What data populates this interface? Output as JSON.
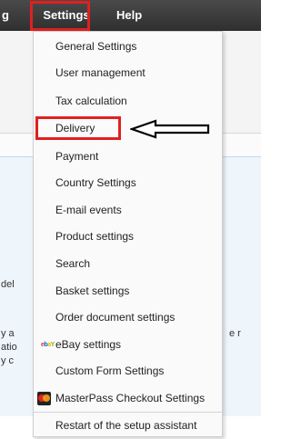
{
  "menubar": {
    "partial_left": "g",
    "settings": "Settings",
    "help": "Help"
  },
  "background": {
    "fragments": [
      "del",
      "y a",
      "atio",
      "y c",
      "e r"
    ]
  },
  "dropdown": {
    "items": [
      {
        "label": "General Settings"
      },
      {
        "label": "User management"
      },
      {
        "label": "Tax calculation"
      },
      {
        "label": "Delivery"
      },
      {
        "label": "Payment"
      },
      {
        "label": "Country Settings"
      },
      {
        "label": "E-mail events"
      },
      {
        "label": "Product settings"
      },
      {
        "label": "Search"
      },
      {
        "label": "Basket settings"
      },
      {
        "label": "Order document settings"
      },
      {
        "label": "eBay settings",
        "icon": "ebay-icon"
      },
      {
        "label": "Custom Form Settings"
      },
      {
        "label": "MasterPass Checkout Settings",
        "icon": "masterpass-icon"
      },
      {
        "label": "Restart of the setup assistant"
      }
    ]
  },
  "ebay_logo": {
    "e": "e",
    "b": "b",
    "a": "a",
    "y": "Y"
  },
  "highlight": {
    "color": "#e02020",
    "highlighted": [
      "Settings",
      "Delivery"
    ]
  }
}
